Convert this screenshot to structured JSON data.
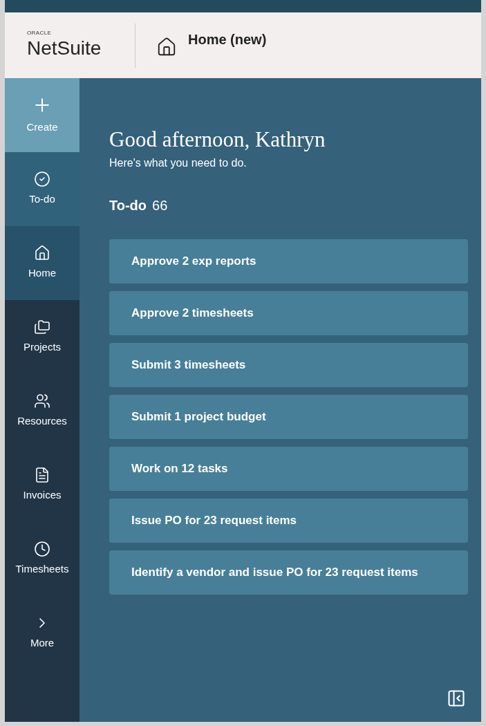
{
  "header": {
    "logo_small": "ORACLE",
    "logo": "NetSuite",
    "page_title": "Home (new)"
  },
  "sidebar": {
    "items": [
      {
        "label": "Create",
        "kind": "create",
        "selected": false
      },
      {
        "label": "To-do",
        "kind": "todo",
        "selected": false
      },
      {
        "label": "Home",
        "kind": "nav",
        "selected": true
      },
      {
        "label": "Projects",
        "kind": "nav",
        "selected": false
      },
      {
        "label": "Resources",
        "kind": "nav",
        "selected": false
      },
      {
        "label": "Invoices",
        "kind": "nav",
        "selected": false
      },
      {
        "label": "Timesheets",
        "kind": "nav",
        "selected": false
      },
      {
        "label": "More",
        "kind": "nav",
        "selected": false
      }
    ]
  },
  "main": {
    "greeting": "Good afternoon, Kathryn",
    "subtitle": "Here's what you need to do.",
    "todo_label": "To-do",
    "todo_count": "66",
    "tasks": [
      "Approve 2 exp reports",
      "Approve 2 timesheets",
      "Submit 3 timesheets",
      "Submit 1 project budget",
      "Work on 12 tasks",
      "Issue PO for 23 request items",
      "Identify a vendor and issue PO for 23 request items"
    ]
  }
}
